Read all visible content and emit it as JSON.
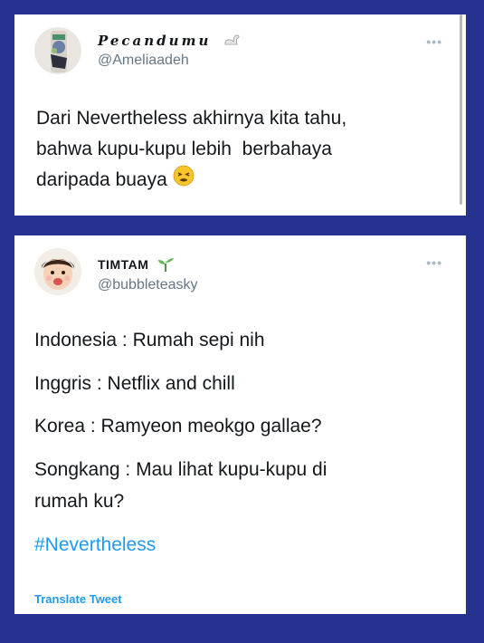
{
  "tweet1": {
    "display_name": "Pecandumu",
    "handle": "@Ameliaadeh",
    "more_label": "•••",
    "text_lines": [
      "Dari Nevertheless akhirnya kita tahu,",
      "bahwa kupu-kupu lebih  berbahaya",
      "daripada buaya"
    ],
    "emoji_name": "tired-face-emoji",
    "name_emoji_name": "swan-icon"
  },
  "tweet2": {
    "display_name": "TIMTAM",
    "handle": "@bubbleteasky",
    "more_label": "•••",
    "lines": [
      "Indonesia : Rumah sepi nih",
      "Inggris : Netflix and chill",
      "Korea : Ramyeon meokgo gallae?",
      "Songkang : Mau lihat kupu-kupu di",
      "rumah ku?"
    ],
    "hashtag": "#Nevertheless",
    "translate_label": "Translate Tweet",
    "name_emoji_name": "seedling-icon"
  },
  "colors": {
    "background": "#26328f",
    "link": "#1d9bf0",
    "text": "#14171a",
    "muted": "#657786"
  }
}
